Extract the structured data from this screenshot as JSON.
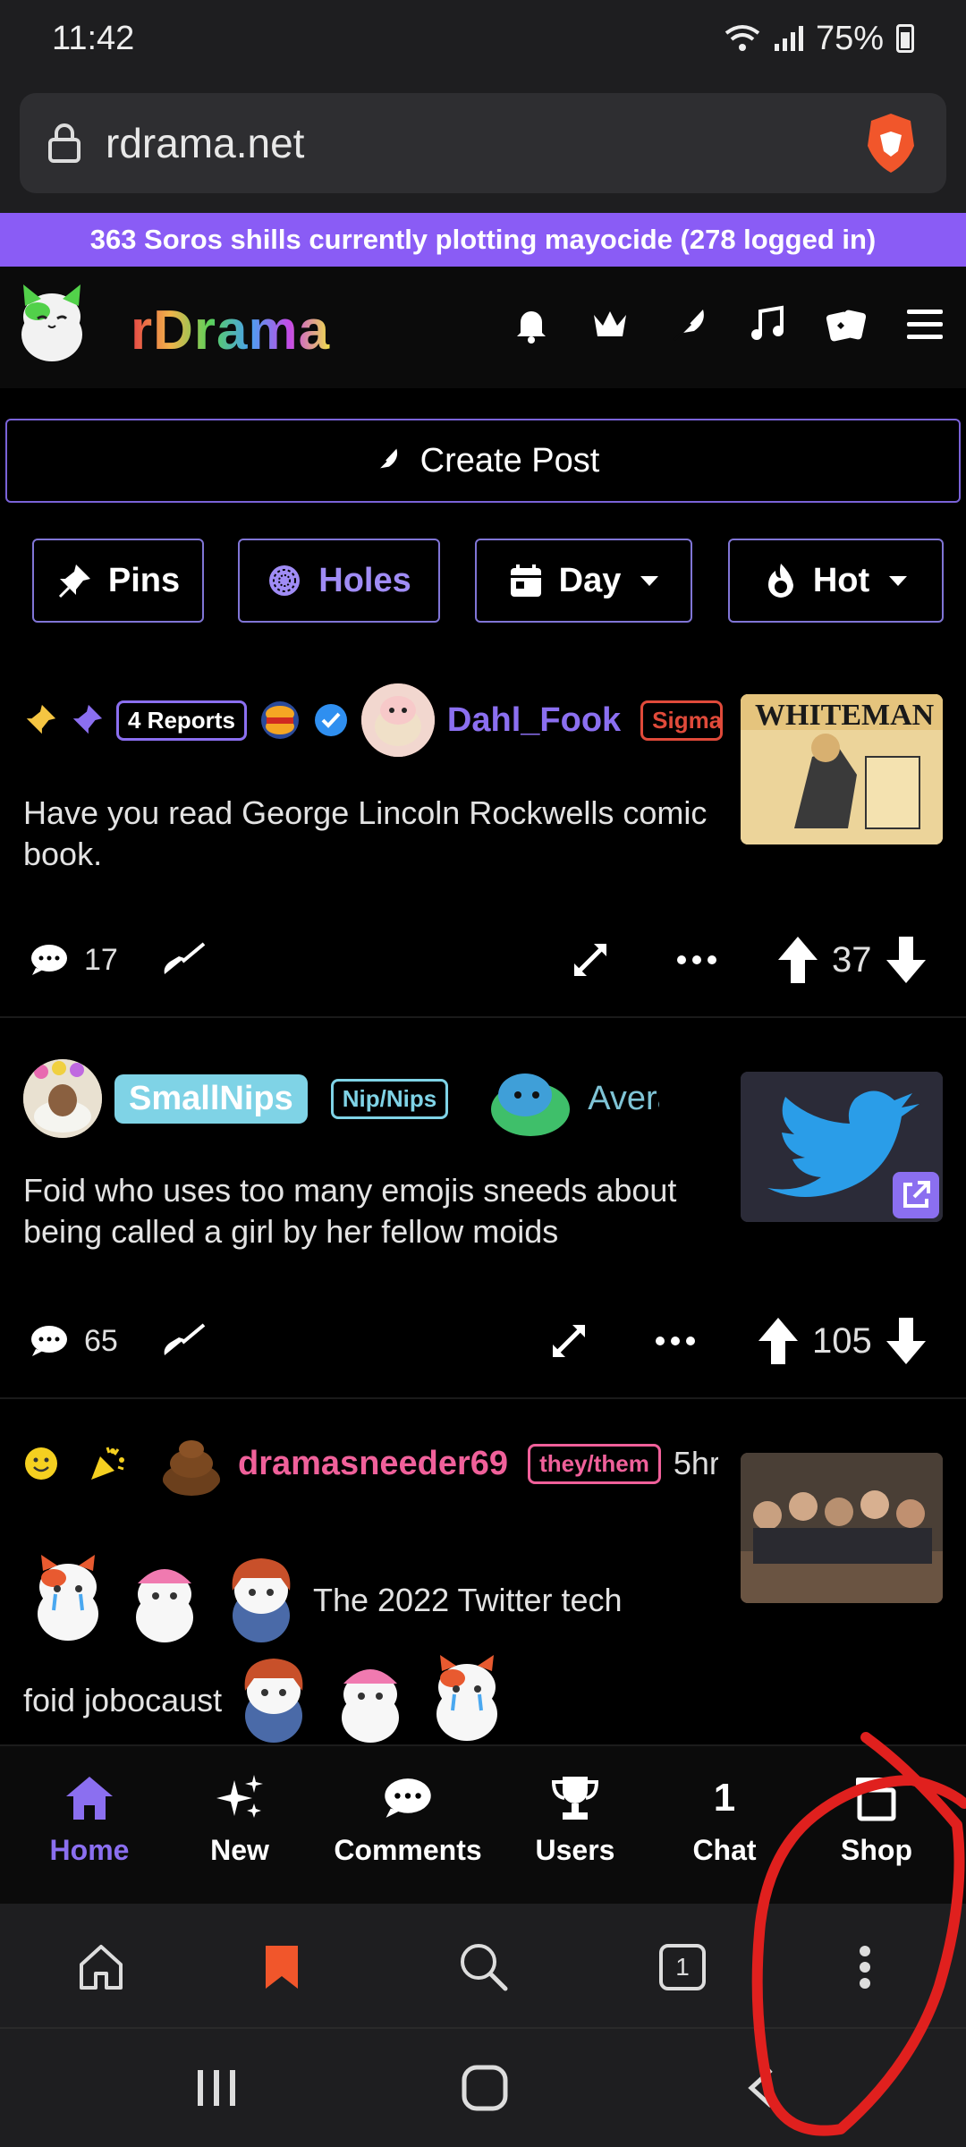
{
  "status_bar": {
    "time": "11:42",
    "battery": "75%"
  },
  "browser": {
    "url": "rdrama.net",
    "tab_count": "1"
  },
  "banner": {
    "text": "363 Soros shills currently plotting mayocide (278 logged in)"
  },
  "site": {
    "logo_text": "rDrama"
  },
  "header_icons": [
    "bell-icon",
    "crown-icon",
    "feather-icon",
    "music-icon",
    "cards-icon",
    "menu-icon"
  ],
  "create_post": {
    "label": "Create Post"
  },
  "filters": {
    "pins": "Pins",
    "holes": "Holes",
    "day": "Day",
    "hot": "Hot"
  },
  "posts": [
    {
      "reports": "4 Reports",
      "username": "Dahl_Fook",
      "flair": "Sigma",
      "title": "Have you read George Lincoln Rockwells comic book.",
      "comments": "17",
      "score": "37",
      "thumb_text": "WHITEMAN",
      "colors": {
        "username": "#8b6ff0",
        "flair": "#e04a3a"
      }
    },
    {
      "username": "SmallNips",
      "flair": "Nip/Nips",
      "custom_title": "Average s",
      "title": "Foid who uses too many emojis sneeds about being called a girl by her fellow moids",
      "comments": "65",
      "score": "105",
      "colors": {
        "username_bg": "#7fd3e6",
        "flair": "#7fd3e6",
        "custom_title": "#7fc4d6"
      }
    },
    {
      "username": "dramasneeder69",
      "flair": "they/them",
      "time": "5hr",
      "title_part1": "The 2022 Twitter tech",
      "title_part2": "foid jobocaust",
      "colors": {
        "username": "#f0609a",
        "flair": "#f0609a"
      }
    }
  ],
  "bottom_nav": {
    "home": "Home",
    "new": "New",
    "comments": "Comments",
    "users": "Users",
    "chat": "Chat",
    "chat_count": "1",
    "shop": "Shop"
  },
  "accent": "#8b6ff0"
}
